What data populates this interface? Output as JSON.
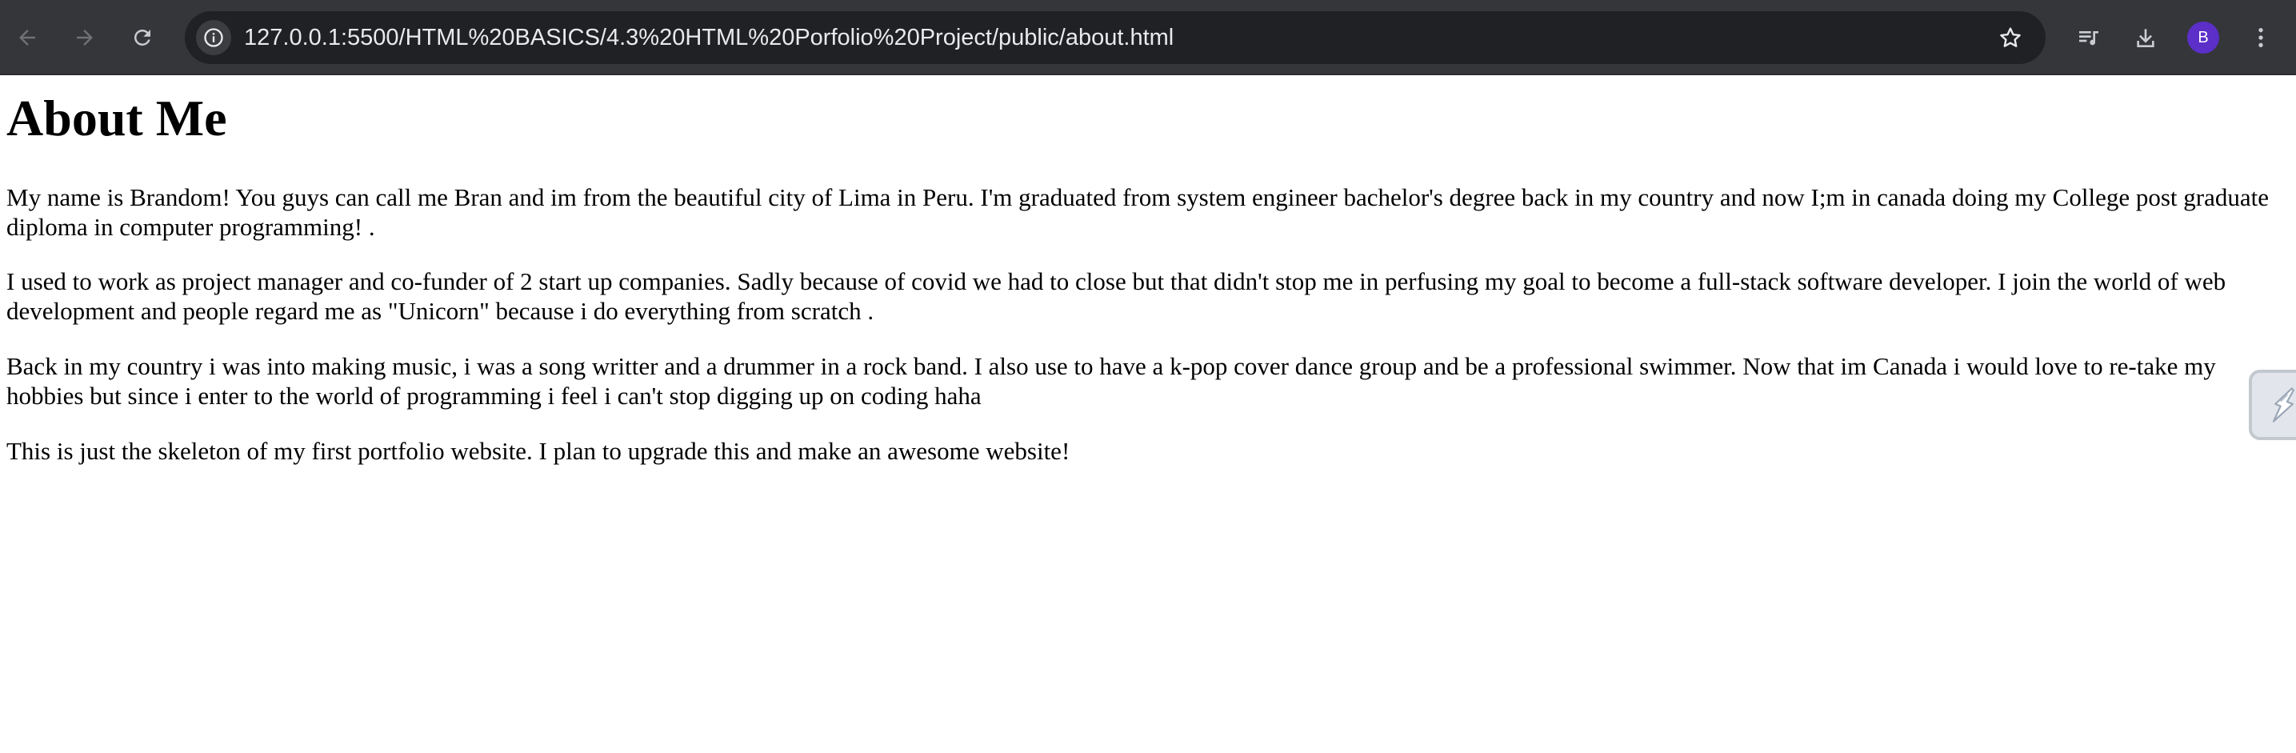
{
  "browser": {
    "url": "127.0.0.1:5500/HTML%20BASICS/4.3%20HTML%20Porfolio%20Project/public/about.html",
    "avatar_initial": "B",
    "icons": {
      "back": "back-arrow-icon",
      "forward": "forward-arrow-icon",
      "reload": "reload-icon",
      "site_info": "site-info-icon",
      "bookmark": "star-icon",
      "media": "media-queue-icon",
      "download": "download-icon",
      "menu": "kebab-menu-icon"
    },
    "colors": {
      "toolbar": "#35363a",
      "omnibox": "#202124",
      "avatar": "#5b2fc8"
    }
  },
  "page": {
    "title": "About Me",
    "paragraphs": [
      "My name is Brandom! You guys can call me Bran and im from the beautiful city of Lima in Peru. I'm graduated from system engineer bachelor's degree back in my country and now I;m in canada doing my College post graduate diploma in computer programming! .",
      "I used to work as project manager and co-funder of 2 start up companies. Sadly because of covid we had to close but that didn't stop me in perfusing my goal to become a full-stack software developer. I join the world of web development and people regard me as \"Unicorn\" because i do everything from scratch .",
      "Back in my country i was into making music, i was a song writter and a drummer in a rock band. I also use to have a k-pop cover dance group and be a professional swimmer. Now that im Canada i would love to re-take my hobbies but since i enter to the world of programming i feel i can't stop digging up on coding haha",
      "This is just the skeleton of my first portfolio website. I plan to upgrade this and make an awesome website!"
    ]
  },
  "extension_widget": {
    "icon": "lightning-extension-icon"
  }
}
